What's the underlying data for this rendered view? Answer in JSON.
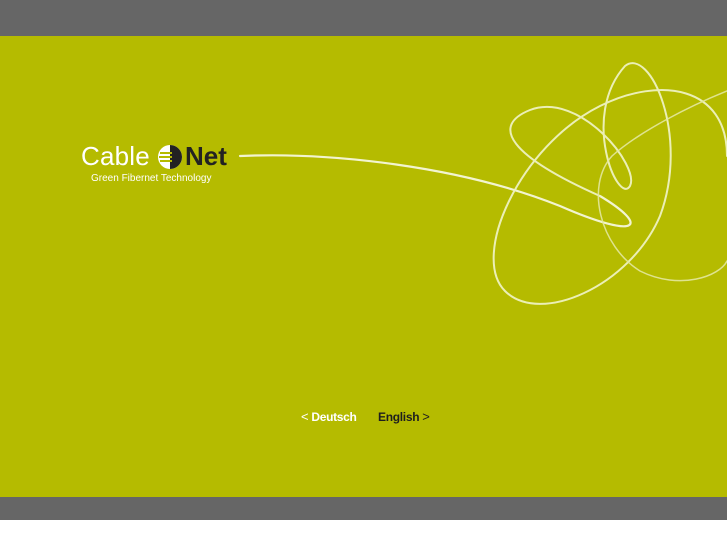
{
  "header": {},
  "logo": {
    "word_light": "Cable",
    "word_bold": "Net",
    "tagline": "Green Fibernet Technology",
    "icon": "cable-ball-icon"
  },
  "languages": {
    "deutsch": {
      "arrow": "<",
      "label": "Deutsch"
    },
    "english": {
      "label": "English",
      "arrow": ">"
    }
  },
  "colors": {
    "background": "#b5bb00",
    "bars": "#666666",
    "logo_dark": "#222222",
    "link_white": "#ffffff"
  }
}
